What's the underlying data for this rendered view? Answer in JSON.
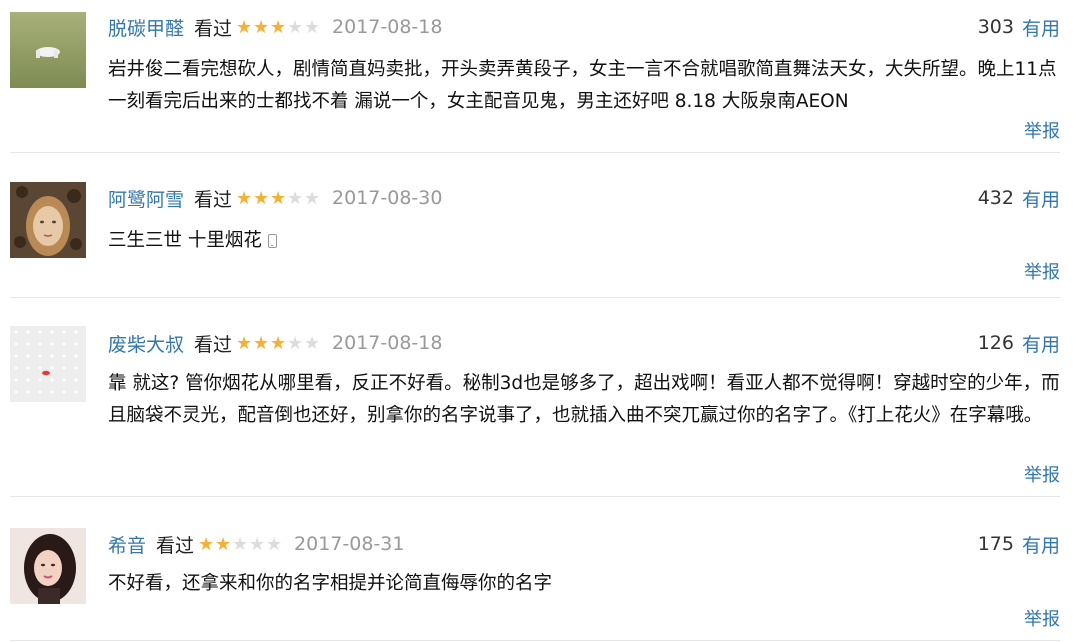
{
  "reviews": [
    {
      "username": "脱碳甲醛",
      "status": "看过",
      "rating": 3,
      "date": "2017-08-18",
      "votes": "303",
      "useful_label": "有用",
      "content": "岩井俊二看完想砍人，剧情简直妈卖批，开头卖弄黄段子，女主一言不合就唱歌简直舞法天女，大失所望。晚上11点一刻看完后出来的士都找不着 漏说一个，女主配音见鬼，男主还好吧 8.18 大阪泉南AEON",
      "report_label": "举报",
      "mobile": false
    },
    {
      "username": "阿鹭阿雪",
      "status": "看过",
      "rating": 3,
      "date": "2017-08-30",
      "votes": "432",
      "useful_label": "有用",
      "content": "三生三世 十里烟花",
      "report_label": "举报",
      "mobile": true
    },
    {
      "username": "废柴大叔",
      "status": "看过",
      "rating": 3,
      "date": "2017-08-18",
      "votes": "126",
      "useful_label": "有用",
      "content": "靠 就这? 管你烟花从哪里看，反正不好看。秘制3d也是够多了，超出戏啊！看亚人都不觉得啊！穿越时空的少年，而且脑袋不灵光，配音倒也还好，别拿你的名字说事了，也就插入曲不突兀赢过你的名字了。《打上花火》在字幕哦。",
      "report_label": "举报",
      "mobile": false
    },
    {
      "username": "希音",
      "status": "看过",
      "rating": 2,
      "date": "2017-08-31",
      "votes": "175",
      "useful_label": "有用",
      "content": "不好看，还拿来和你的名字相提并论简直侮辱你的名字",
      "report_label": "举报",
      "mobile": false
    }
  ],
  "colors": {
    "link": "#3377aa",
    "star_on": "#f6b036",
    "star_off": "#dcdcdc",
    "date": "#999999"
  }
}
